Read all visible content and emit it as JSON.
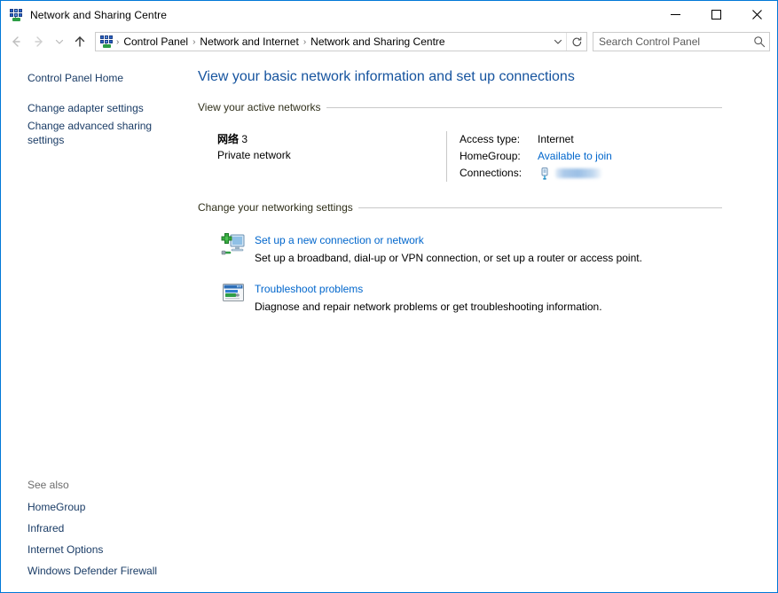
{
  "window": {
    "title": "Network and Sharing Centre",
    "icon": "network-sharing-icon",
    "controls": {
      "minimize": "Minimize",
      "maximize": "Maximize",
      "close": "Close"
    },
    "accent_color": "#0078d7"
  },
  "navbar": {
    "back": "Back",
    "forward": "Forward",
    "recent": "Recent locations",
    "up": "Up one level",
    "breadcrumbs": [
      "Control Panel",
      "Network and Internet",
      "Network and Sharing Centre"
    ],
    "separator": "›",
    "dropdown": "Previous locations",
    "refresh": "Refresh",
    "search": {
      "placeholder": "Search Control Panel",
      "value": "",
      "icon": "search-icon"
    }
  },
  "sidebar": {
    "items": [
      {
        "label": "Control Panel Home"
      },
      {
        "label": "Change adapter settings"
      },
      {
        "label": "Change advanced sharing settings"
      }
    ],
    "see_also": {
      "title": "See also",
      "items": [
        {
          "label": "HomeGroup"
        },
        {
          "label": "Infrared"
        },
        {
          "label": "Internet Options"
        },
        {
          "label": "Windows Defender Firewall"
        }
      ]
    }
  },
  "main": {
    "page_title": "View your basic network information and set up connections",
    "active_networks": {
      "heading": "View your active networks",
      "network": {
        "name": "网络",
        "number": "3",
        "type": "Private network"
      },
      "details": [
        {
          "label": "Access type:",
          "value": "Internet",
          "is_link": false
        },
        {
          "label": "HomeGroup:",
          "value": "Available to join",
          "is_link": true
        },
        {
          "label": "Connections:",
          "value": "",
          "is_link": true,
          "icon": "network-adapter-icon",
          "redacted": true
        }
      ]
    },
    "networking_settings": {
      "heading": "Change your networking settings",
      "actions": [
        {
          "icon": "new-connection-icon",
          "link": "Set up a new connection or network",
          "description": "Set up a broadband, dial-up or VPN connection, or set up a router or access point."
        },
        {
          "icon": "troubleshoot-icon",
          "link": "Troubleshoot problems",
          "description": "Diagnose and repair network problems or get troubleshooting information."
        }
      ]
    }
  },
  "colors": {
    "link": "#0066cc",
    "title_link": "#15539e",
    "sidebar_link": "#1a3c66",
    "section_heading": "#2f2f1a",
    "window_border": "#0078d7"
  }
}
